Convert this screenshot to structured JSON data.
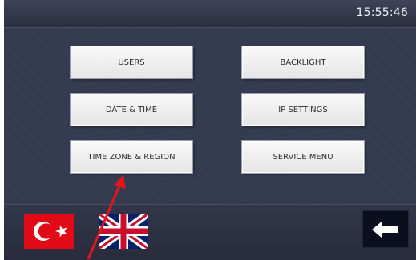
{
  "status_bar": {
    "time": "15:55:46"
  },
  "menu": {
    "users": "USERS",
    "backlight": "BACKLIGHT",
    "date_time": "DATE & TIME",
    "ip_settings": "IP SETTINGS",
    "time_zone_region": "TIME ZONE & REGION",
    "service_menu": "SERVICE MENU"
  },
  "languages": [
    "turkish-flag-icon",
    "uk-flag-icon"
  ],
  "icons": {
    "back": "arrow-left-icon"
  },
  "colors": {
    "background": "#333a4f",
    "button": "#f2f2f2",
    "annotation_arrow": "#e8141c",
    "turkey_red": "#e30a17",
    "uk_blue": "#012169",
    "uk_red": "#c8102e"
  }
}
